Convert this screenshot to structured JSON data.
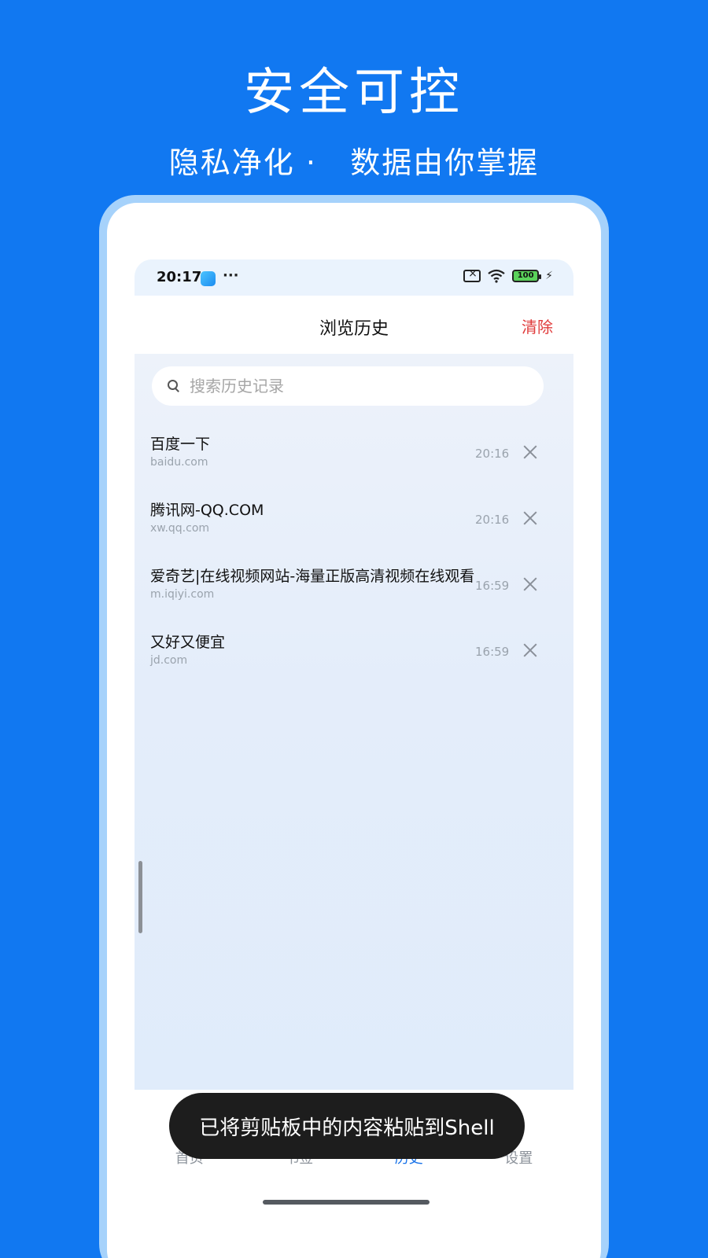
{
  "promo": {
    "title": "安全可控",
    "subtitle": "隐私净化 ·   数据由你掌握"
  },
  "statusbar": {
    "time": "20:17",
    "dots": "···",
    "battery": "100",
    "icons": [
      "app-icon",
      "sim-off-icon",
      "wifi-icon",
      "battery-icon",
      "charging-icon"
    ]
  },
  "header": {
    "title": "浏览历史",
    "clear_label": "清除",
    "clear_color": "#e03c3c"
  },
  "search": {
    "placeholder": "搜索历史记录",
    "value": ""
  },
  "history": [
    {
      "title": "百度一下",
      "url": "baidu.com",
      "time": "20:16"
    },
    {
      "title": "腾讯网-QQ.COM",
      "url": "xw.qq.com",
      "time": "20:16"
    },
    {
      "title": "爱奇艺|在线视频网站-海量正版高清视频在线观看",
      "url": "m.iqiyi.com",
      "time": "16:59"
    },
    {
      "title": "又好又便宜",
      "url": "jd.com",
      "time": "16:59"
    }
  ],
  "nav": {
    "items": [
      {
        "label": "首页"
      },
      {
        "label": "书签"
      },
      {
        "label": "历史"
      },
      {
        "label": "设置"
      }
    ],
    "active_index": 2,
    "active_color": "#1a73e8"
  },
  "toast": {
    "text": "已将剪贴板中的内容粘贴到Shell"
  },
  "colors": {
    "background": "#1178f1",
    "phone_frame": "#a6d2fb"
  }
}
